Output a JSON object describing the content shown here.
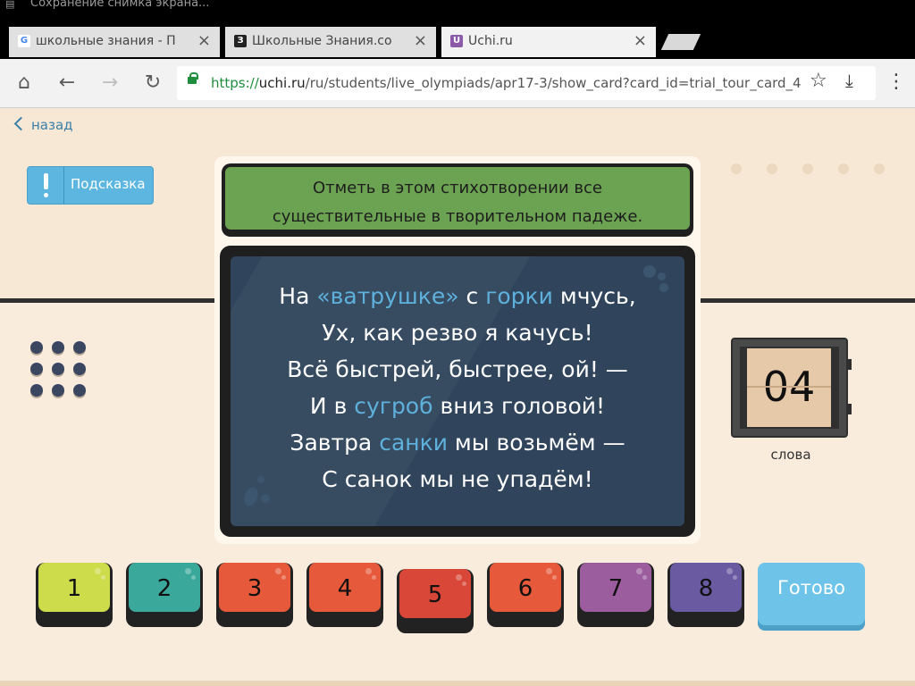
{
  "status_bar": {
    "notification_text": "Сохранение снимка экрана..."
  },
  "tabs": [
    {
      "title": "школьные знания - Поиск в Google",
      "favicon": "google-icon",
      "favicon_glyph": "G"
    },
    {
      "title": "Школьные Знания.com - Вопрос",
      "favicon": "znanija-icon",
      "favicon_glyph": "З"
    },
    {
      "title": "Uchi.ru",
      "favicon": "uchi-icon",
      "favicon_glyph": "U"
    }
  ],
  "toolbar": {
    "url_scheme": "https://",
    "url_host": "uchi.ru",
    "url_path": "/ru/students/live_olympiads/apr17-3/show_card?card_id=trial_tour_card_4"
  },
  "page": {
    "back_label": "назад",
    "hint_label": "Подсказка",
    "task_line1": "Отметь в этом стихотворении все",
    "task_line2": "существительные в творительном падеже.",
    "poem": [
      [
        {
          "t": "На ",
          "h": false
        },
        {
          "t": "«ватрушке»",
          "h": true
        },
        {
          "t": " с ",
          "h": false
        },
        {
          "t": "горки",
          "h": true
        },
        {
          "t": " мчусь,",
          "h": false
        }
      ],
      [
        {
          "t": "Ух, как резво я качусь!",
          "h": false
        }
      ],
      [
        {
          "t": "Всё быстрей, быстрее, ой! —",
          "h": false
        }
      ],
      [
        {
          "t": "И в ",
          "h": false
        },
        {
          "t": "сугроб",
          "h": true
        },
        {
          "t": " вниз головой!",
          "h": false
        }
      ],
      [
        {
          "t": "Завтра ",
          "h": false
        },
        {
          "t": "санки",
          "h": true
        },
        {
          "t": " мы возьмём —",
          "h": false
        }
      ],
      [
        {
          "t": "С санок мы не упадём!",
          "h": false
        }
      ]
    ],
    "counter_value": "04",
    "counter_label": "слова",
    "answers": [
      {
        "label": "1",
        "color": "#cddc4a"
      },
      {
        "label": "2",
        "color": "#3aa89a"
      },
      {
        "label": "3",
        "color": "#e65a3b"
      },
      {
        "label": "4",
        "color": "#e65a3b"
      },
      {
        "label": "5",
        "color": "#d94738"
      },
      {
        "label": "6",
        "color": "#e65a3b"
      },
      {
        "label": "7",
        "color": "#9c5d9e"
      },
      {
        "label": "8",
        "color": "#6a5aa2"
      }
    ],
    "ready_label": "Готово"
  },
  "colors": {
    "accent_link": "#3a7fa8",
    "highlight_word": "#5eb1dc",
    "task_green": "#6ca352",
    "poem_bg": "#30455c",
    "hint_blue": "#5cb6e0",
    "ready_blue": "#6ec3e8"
  }
}
